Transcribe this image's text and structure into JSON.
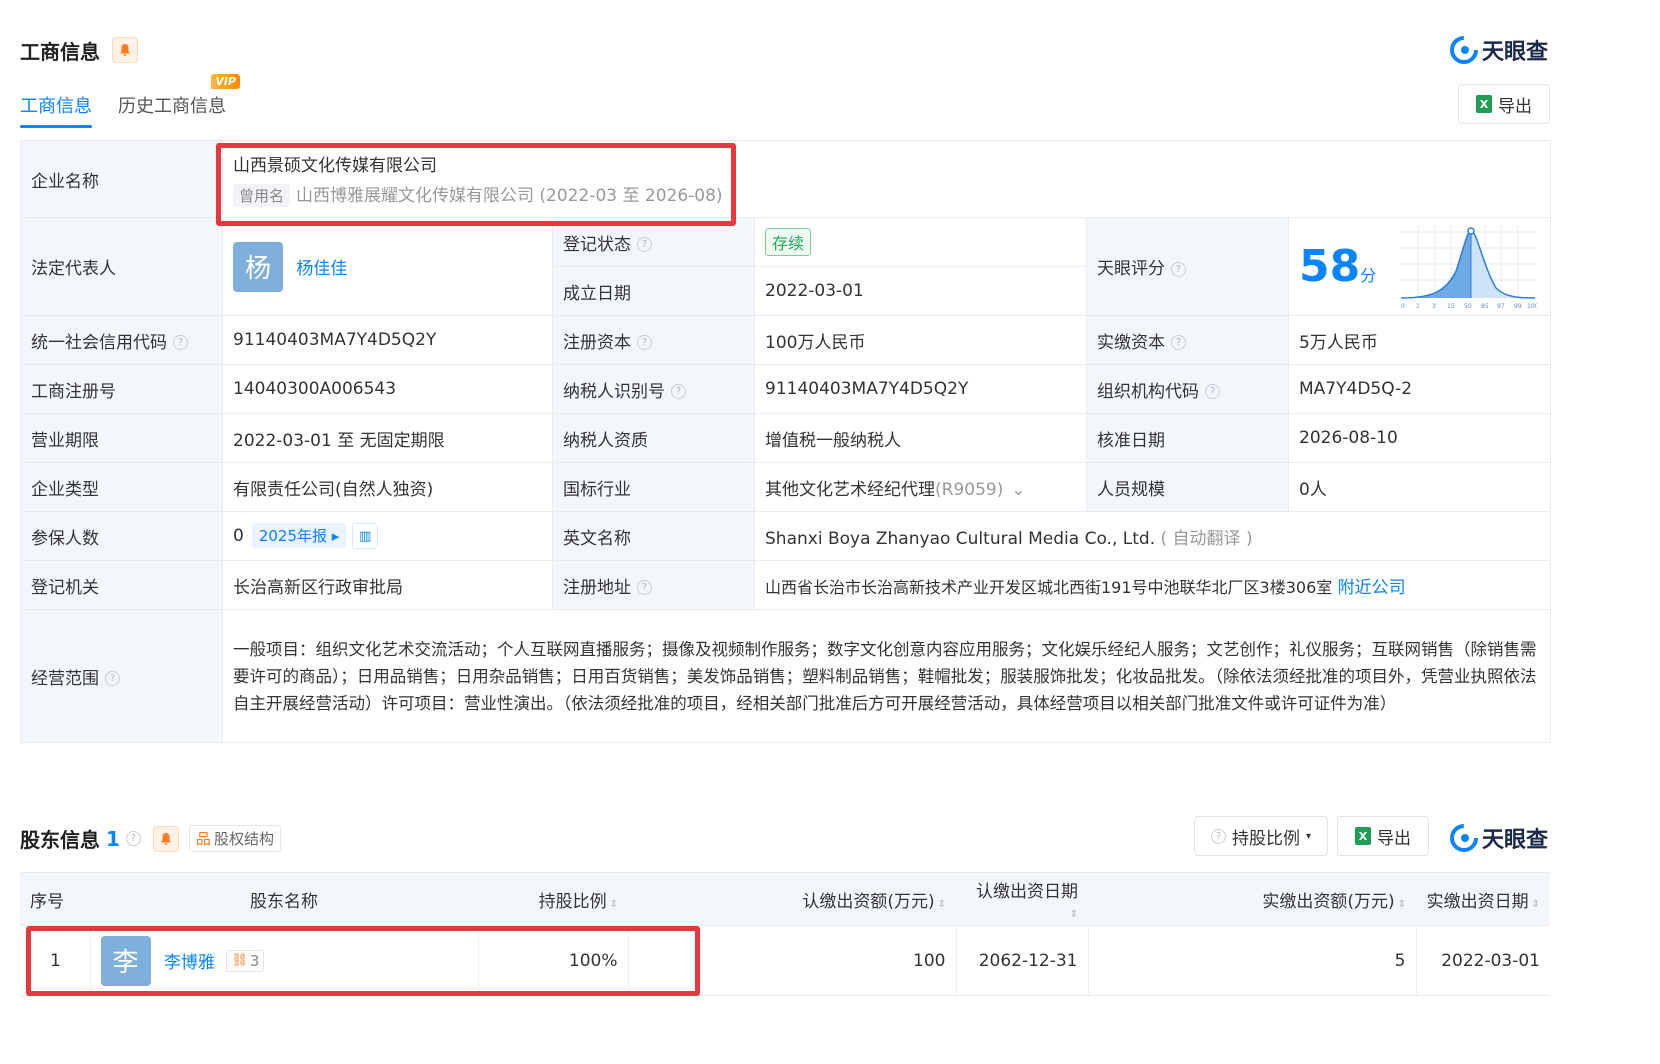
{
  "section1": {
    "title": "工商信息",
    "tabs": [
      "工商信息",
      "历史工商信息"
    ],
    "vip_badge": "VIP",
    "export_label": "导出",
    "logo_text": "天眼查"
  },
  "info": {
    "company_name_label": "企业名称",
    "company_name": "山西景硕文化传媒有限公司",
    "former_name_tag": "曾用名",
    "former_name": "山西博雅展耀文化传媒有限公司 (2022-03 至 2026-08)",
    "legal_rep_label": "法定代表人",
    "legal_rep_avatar": "杨",
    "legal_rep_name": "杨佳佳",
    "reg_status_label": "登记状态",
    "reg_status": "存续",
    "found_date_label": "成立日期",
    "found_date": "2022-03-01",
    "tianyan_score_label": "天眼评分",
    "tianyan_score": "58",
    "tianyan_score_unit": "分",
    "score_axis": [
      "0",
      "1",
      "3",
      "15",
      "50",
      "85",
      "97",
      "99",
      "100"
    ],
    "credit_code_label": "统一社会信用代码",
    "credit_code": "91140403MA7Y4D5Q2Y",
    "reg_capital_label": "注册资本",
    "reg_capital": "100万人民币",
    "paid_capital_label": "实缴资本",
    "paid_capital": "5万人民币",
    "biz_reg_no_label": "工商注册号",
    "biz_reg_no": "14040300A006543",
    "taxpayer_id_label": "纳税人识别号",
    "taxpayer_id": "91140403MA7Y4D5Q2Y",
    "org_code_label": "组织机构代码",
    "org_code": "MA7Y4D5Q-2",
    "term_label": "营业期限",
    "term": "2022-03-01 至 无固定期限",
    "taxpayer_qual_label": "纳税人资质",
    "taxpayer_qual": "增值税一般纳税人",
    "approve_date_label": "核准日期",
    "approve_date": "2026-08-10",
    "type_label": "企业类型",
    "type": "有限责任公司(自然人独资)",
    "industry_label": "国标行业",
    "industry": "其他文化艺术经纪代理",
    "industry_code": "(R9059)",
    "staff_label": "人员规模",
    "staff": "0人",
    "insured_label": "参保人数",
    "insured": "0",
    "insured_report": "2025年报",
    "english_name_label": "英文名称",
    "english_name": "Shanxi Boya Zhanyao Cultural Media Co., Ltd.",
    "english_name_note": "( 自动翻译 )",
    "authority_label": "登记机关",
    "authority": "长治高新区行政审批局",
    "address_label": "注册地址",
    "address": "山西省长治市长治高新技术产业开发区城北西街191号中池联华北厂区3楼306室",
    "nearby_link": "附近公司",
    "scope_label": "经营范围",
    "scope": "一般项目：组织文化艺术交流活动；个人互联网直播服务；摄像及视频制作服务；数字文化创意内容应用服务；文化娱乐经纪人服务；文艺创作；礼仪服务；互联网销售（除销售需要许可的商品）；日用品销售；日用杂品销售；日用百货销售；美发饰品销售；塑料制品销售；鞋帽批发；服装服饰批发；化妆品批发。（除依法须经批准的项目外，凭营业执照依法自主开展经营活动）许可项目：营业性演出。（依法须经批准的项目，经相关部门批准后方可开展经营活动，具体经营项目以相关部门批准文件或许可证件为准）"
  },
  "section2": {
    "title": "股东信息",
    "count": "1",
    "equity_structure": "股权结构",
    "ratio_filter": "持股比例",
    "export_label": "导出",
    "logo_text": "天眼查"
  },
  "shareholders": {
    "headers": [
      "序号",
      "股东名称",
      "持股比例",
      "认缴出资额(万元)",
      "认缴出资日期",
      "实缴出资额(万元)",
      "实缴出资日期"
    ],
    "rows": [
      {
        "index": "1",
        "avatar": "李",
        "name": "李博雅",
        "related_count": "3",
        "ratio": "100%",
        "subscribed_amount": "100",
        "subscribed_date": "2062-12-31",
        "paid_amount": "5",
        "paid_date": "2022-03-01"
      }
    ]
  },
  "colors": {
    "accent": "#0a84ff",
    "highlight_box": "#e5393f",
    "status_green": "#22a85b"
  }
}
